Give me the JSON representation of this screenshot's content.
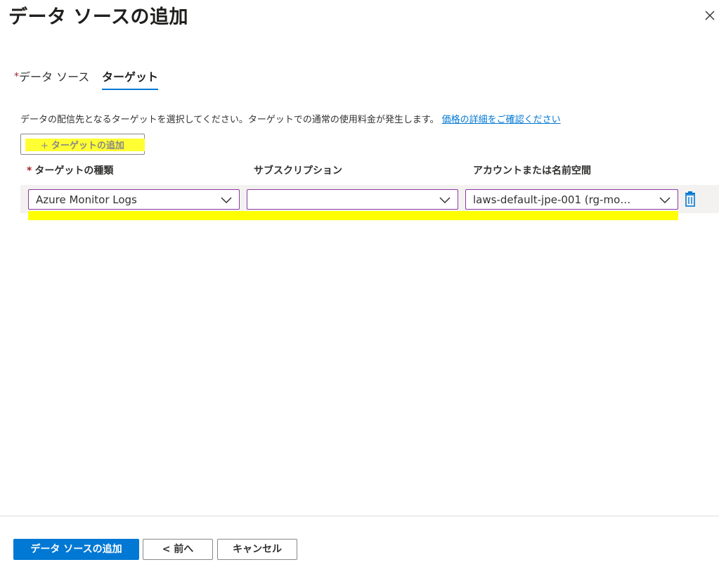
{
  "panel": {
    "title": "データ ソースの追加",
    "close_icon": "close-icon"
  },
  "tabs": [
    {
      "label": "データ ソース",
      "required_marker": "*",
      "active": false
    },
    {
      "label": "ターゲット",
      "active": true
    }
  ],
  "description": {
    "text": "データの配信先となるターゲットを選択してください。ターゲットでの通常の使用料金が発生します。",
    "link_text": "価格の詳細をご確認ください"
  },
  "add_target": {
    "plus": "+",
    "label": "ターゲットの追加",
    "disabled": true
  },
  "columns": {
    "type": {
      "label": "ターゲットの種類",
      "required_marker": "*"
    },
    "subscription": {
      "label": "サブスクリプション"
    },
    "account": {
      "label": "アカウントまたは名前空間"
    }
  },
  "row": {
    "type_value": "Azure Monitor Logs",
    "subscription_value": "",
    "account_value": "laws-default-jpe-001 (rg-mo…",
    "delete_icon": "trash-icon"
  },
  "footer": {
    "primary_label": "データ ソースの追加",
    "prev_label": "< 前へ",
    "cancel_label": "キャンセル"
  },
  "colors": {
    "accent": "#0078d4",
    "highlight": "#ffff00",
    "dropdown_border": "#8c3a9e",
    "required": "#a4262c"
  }
}
